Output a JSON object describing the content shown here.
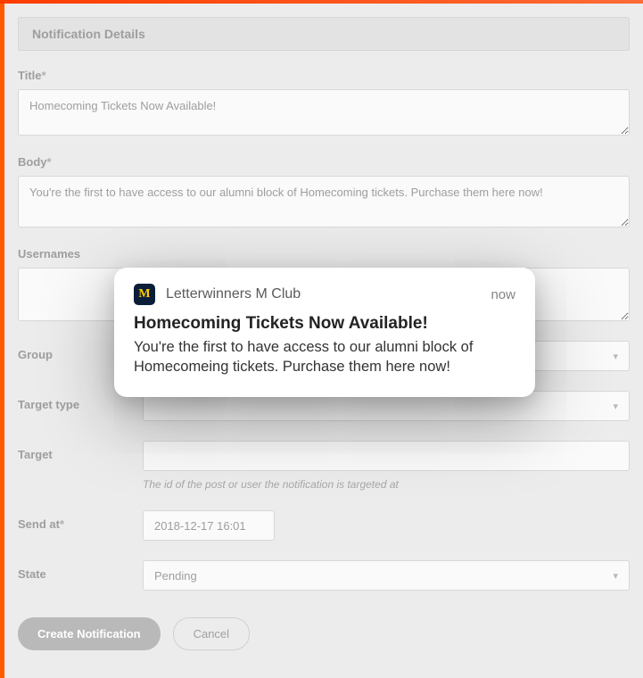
{
  "section_header": "Notification Details",
  "fields": {
    "title": {
      "label": "Title",
      "required": "*",
      "value": "Homecoming Tickets Now Available!"
    },
    "body": {
      "label": "Body",
      "required": "*",
      "value": "You're the first to have access to our alumni block of Homecoming tickets. Purchase them here now!"
    },
    "usernames": {
      "label": "Usernames",
      "value": ""
    },
    "group": {
      "label": "Group",
      "value": ""
    },
    "target_type": {
      "label": "Target type",
      "value": ""
    },
    "target": {
      "label": "Target",
      "value": "",
      "hint": "The id of the post or user the notification is targeted at"
    },
    "send_at": {
      "label": "Send at",
      "required": "*",
      "value": "2018-12-17 16:01"
    },
    "state": {
      "label": "State",
      "value": "Pending"
    }
  },
  "actions": {
    "create": "Create Notification",
    "cancel": "Cancel"
  },
  "popup": {
    "app_letter": "M",
    "app_name": "Letterwinners M Club",
    "time": "now",
    "title": "Homecoming Tickets Now Available!",
    "body": "You're the first to have access to our alumni block of Homecomeing tickets. Purchase them here now!"
  }
}
